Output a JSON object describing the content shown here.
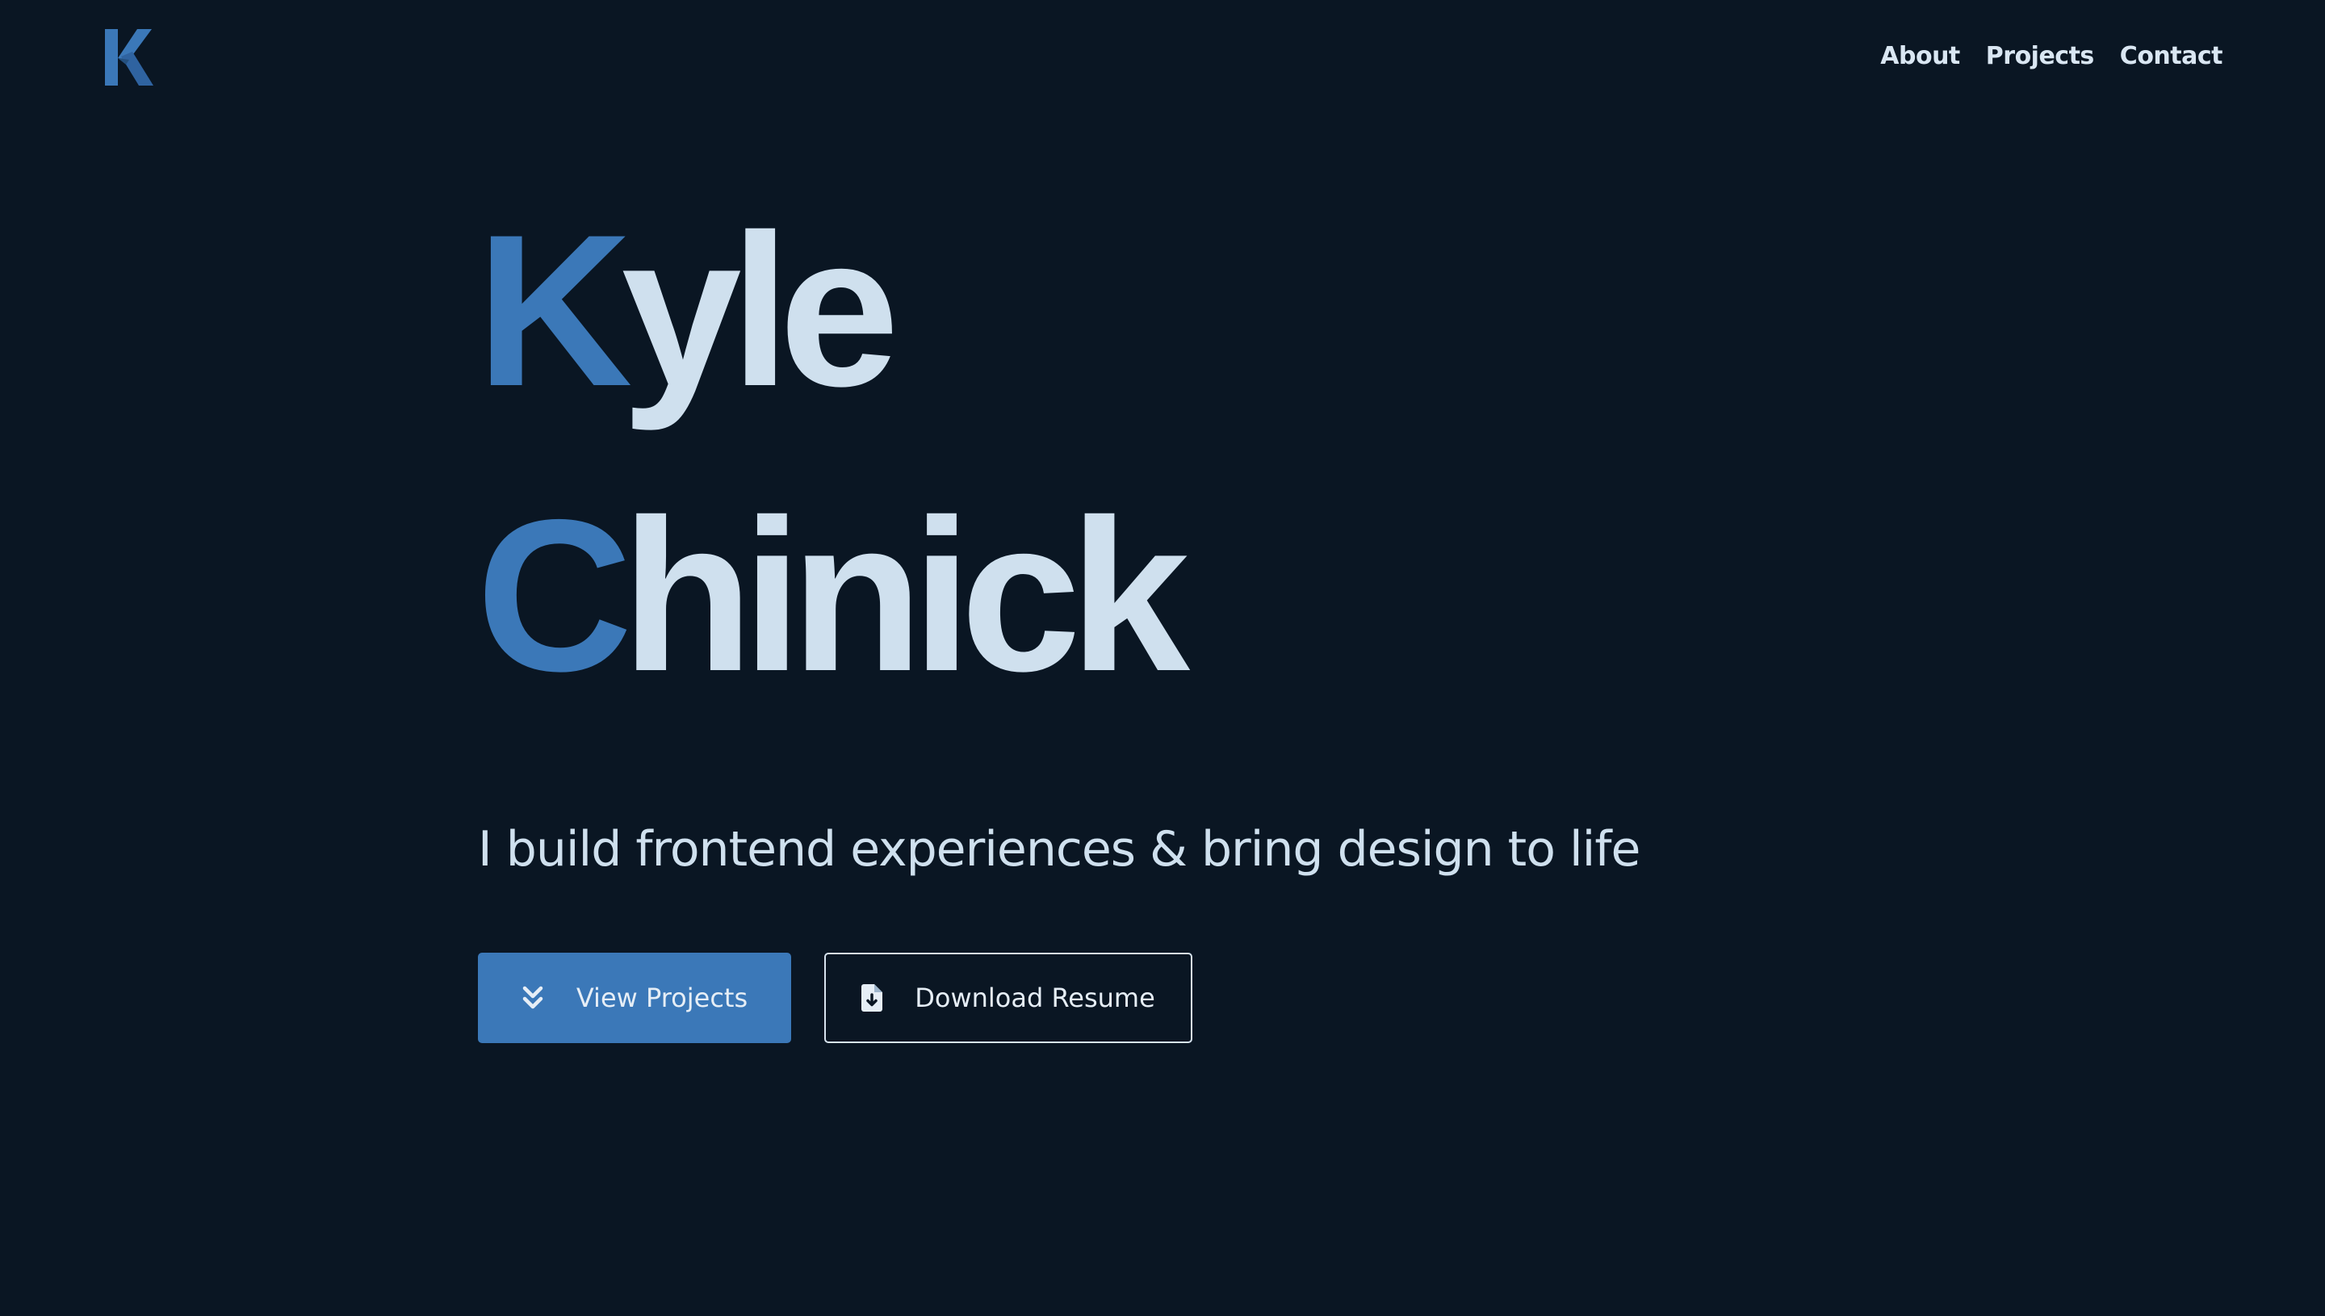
{
  "header": {
    "logo_letter": "K",
    "logo_icon": "k-monogram-logo",
    "nav": [
      {
        "label": "About"
      },
      {
        "label": "Projects"
      },
      {
        "label": "Contact"
      }
    ]
  },
  "hero": {
    "first_name_initial": "K",
    "first_name_rest": "yle",
    "last_name_initial": "C",
    "last_name_rest": "hinick",
    "tagline": "I build frontend experiences & bring design to life"
  },
  "actions": {
    "primary": {
      "label": "View Projects",
      "icon": "chevrons-down-icon"
    },
    "secondary": {
      "label": "Download Resume",
      "icon": "file-download-icon"
    }
  },
  "colors": {
    "background": "#0a1623",
    "accent": "#3b78b8",
    "text": "#cfe0ee"
  }
}
